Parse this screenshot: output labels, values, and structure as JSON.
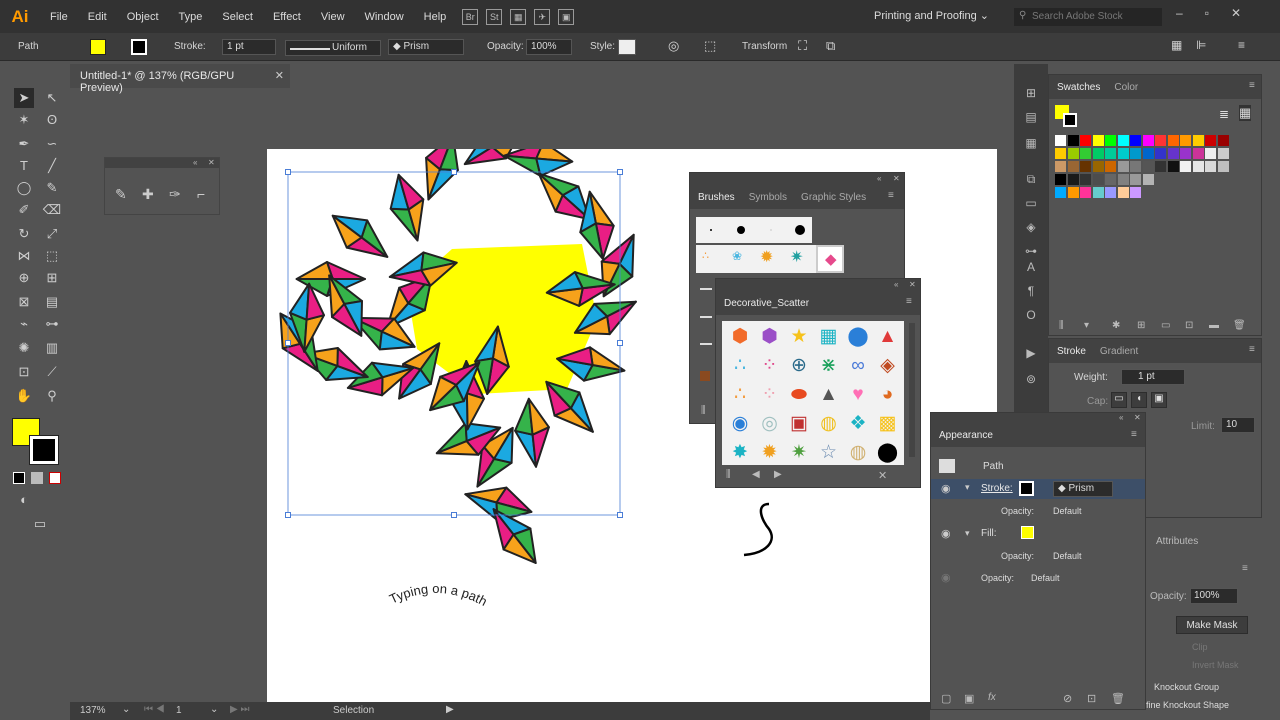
{
  "app": {
    "logo": "Ai"
  },
  "menu": [
    "File",
    "Edit",
    "Object",
    "Type",
    "Select",
    "Effect",
    "View",
    "Window",
    "Help"
  ],
  "bridge_icons": [
    "Br",
    "St"
  ],
  "workspace": "Printing and Proofing",
  "stock_search_placeholder": "Search Adobe Stock",
  "control": {
    "selection_label": "Path",
    "stroke_label": "Stroke:",
    "stroke_value": "1 pt",
    "profile": "Uniform",
    "brush": "Prism",
    "opacity_label": "Opacity:",
    "opacity_value": "100%",
    "style_label": "Style:",
    "transform": "Transform"
  },
  "document_tab": "Untitled-1* @ 137% (RGB/GPU Preview)",
  "artwork": {
    "text_on_path": "Typing on a path"
  },
  "brushes_panel": {
    "tabs": [
      "Brushes",
      "Symbols",
      "Graphic Styles"
    ]
  },
  "scatter_library": {
    "title": "Decorative_Scatter"
  },
  "swatches_panel": {
    "tabs": [
      "Swatches",
      "Color"
    ]
  },
  "stroke_panel": {
    "tabs": [
      "Stroke",
      "Gradient"
    ],
    "weight_label": "Weight:",
    "weight_value": "1 pt",
    "cap_label": "Cap:",
    "limit_label": "Limit:",
    "limit_value": "10"
  },
  "appearance_panel": {
    "title": "Appearance",
    "object": "Path",
    "stroke_label": "Stroke:",
    "stroke_brush": "Prism",
    "opacity1": "Opacity:",
    "opacity1_value": "Default",
    "fill_label": "Fill:",
    "opacity2": "Opacity:",
    "opacity2_value": "Default",
    "opacity3": "Opacity:",
    "opacity3_value": "Default"
  },
  "transparency_panel": {
    "attributes": "Attributes",
    "opacity_label": "Opacity:",
    "opacity_value": "100%",
    "make_mask": "Make Mask",
    "clip": "Clip",
    "invert_mask": "Invert Mask",
    "knockout_group": "Knockout Group",
    "knockout_shape": "fine Knockout Shape"
  },
  "status": {
    "zoom": "137%",
    "artboard": "1",
    "tool": "Selection"
  },
  "colors": {
    "fill": "#ffff00",
    "stroke": "#000000",
    "accent": "#ff9a00"
  }
}
